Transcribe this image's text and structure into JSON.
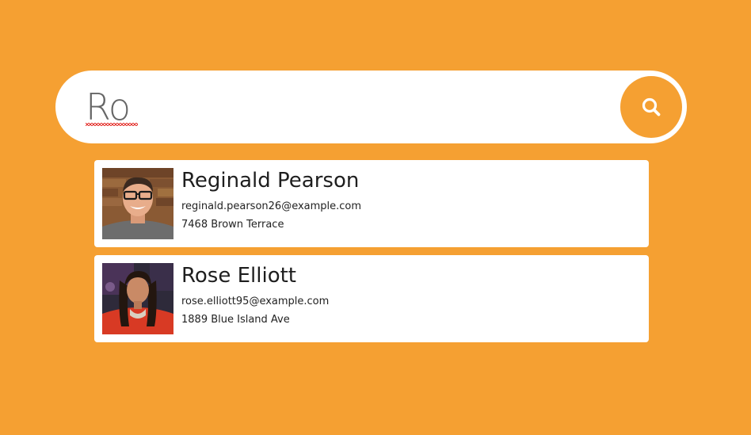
{
  "search": {
    "value": "Ro",
    "button_icon": "search-icon"
  },
  "colors": {
    "background": "#F5A032",
    "accent": "#F5A032",
    "card": "#ffffff"
  },
  "results": [
    {
      "name": "Reginald Pearson",
      "email": "reginald.pearson26@example.com",
      "address": "7468 Brown Terrace",
      "avatar": "avatar-photo"
    },
    {
      "name": "Rose Elliott",
      "email": "rose.elliott95@example.com",
      "address": "1889 Blue Island Ave",
      "avatar": "avatar-photo"
    }
  ]
}
